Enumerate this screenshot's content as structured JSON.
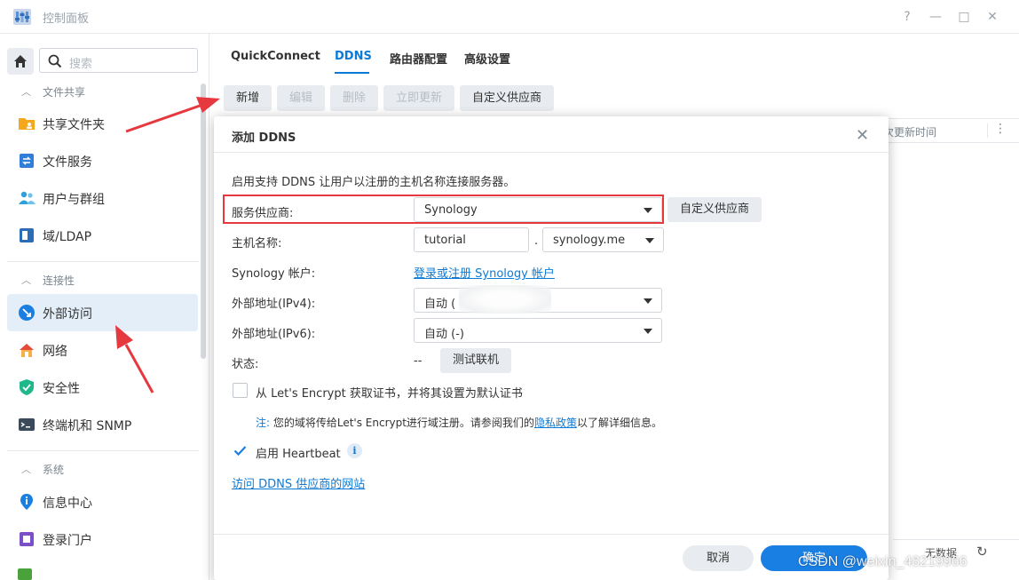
{
  "window": {
    "title": "控制面板",
    "buttons": [
      "?",
      "—",
      "□",
      "✕"
    ]
  },
  "sidebar": {
    "search_placeholder": "搜索",
    "sections": [
      {
        "label": "文件共享",
        "items": [
          {
            "label": "共享文件夹",
            "icon": "shared-folder-icon"
          },
          {
            "label": "文件服务",
            "icon": "file-services-icon"
          },
          {
            "label": "用户与群组",
            "icon": "users-groups-icon"
          },
          {
            "label": "域/LDAP",
            "icon": "domain-ldap-icon"
          }
        ]
      },
      {
        "label": "连接性",
        "items": [
          {
            "label": "外部访问",
            "icon": "external-access-icon",
            "active": true
          },
          {
            "label": "网络",
            "icon": "network-icon"
          },
          {
            "label": "安全性",
            "icon": "security-shield-icon"
          },
          {
            "label": "终端机和 SNMP",
            "icon": "terminal-icon"
          }
        ]
      },
      {
        "label": "系统",
        "items": [
          {
            "label": "信息中心",
            "icon": "info-center-icon"
          },
          {
            "label": "登录门户",
            "icon": "login-portal-icon"
          }
        ]
      }
    ]
  },
  "main": {
    "tabs": [
      "QuickConnect",
      "DDNS",
      "路由器配置",
      "高级设置"
    ],
    "active_tab": "DDNS",
    "toolbar": {
      "add": "新增",
      "edit": "编辑",
      "delete": "删除",
      "update_now": "立即更新",
      "custom_provider": "自定义供应商"
    },
    "table": {
      "column_partial": "次更新时间",
      "more": "⋮"
    },
    "footer": {
      "nodata": "无数据",
      "refresh": "↻"
    }
  },
  "dialog": {
    "title": "添加 DDNS",
    "close": "✕",
    "intro": "启用支持 DDNS 让用户以注册的主机名称连接服务器。",
    "provider_label": "服务供应商:",
    "provider_value": "Synology",
    "custom_provider_button": "自定义供应商",
    "hostname_label": "主机名称:",
    "hostname_value": "tutorial",
    "hostname_sep": ".",
    "domain_value": "synology.me",
    "account_label": "Synology 帐户:",
    "account_link": "登录或注册 Synology 帐户",
    "ipv4_label": "外部地址(IPv4):",
    "ipv4_value": "自动 (",
    "ipv6_label": "外部地址(IPv6):",
    "ipv6_value": "自动 (-)",
    "status_label": "状态:",
    "status_value": "--",
    "test_button": "测试联机",
    "letsencrypt_label": "从 Let's Encrypt 获取证书，并将其设置为默认证书",
    "letsencrypt_checked": false,
    "note_prefix": "注:",
    "note_text": " 您的域将传给Let's Encrypt进行域注册。请参阅我们的",
    "note_link": "隐私政策",
    "note_suffix": "以了解详细信息。",
    "heartbeat_label": "启用 Heartbeat",
    "heartbeat_checked": true,
    "info_glyph": "i",
    "provider_site_link": "访问 DDNS 供应商的网站",
    "cancel": "取消",
    "ok": "确定"
  },
  "watermark": "CSDN @weixin_48219966",
  "colors": {
    "accent": "#0d7bd6",
    "primary_button": "#1a7fe3",
    "highlight_box": "#e6393f",
    "arrow": "#e6393f"
  }
}
